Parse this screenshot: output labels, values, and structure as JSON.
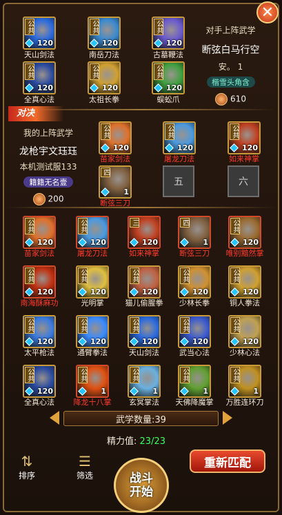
{
  "opponent": {
    "header": "对手上阵武学",
    "name": "断弦白马行空",
    "server": "安。  1",
    "guild": "楷雪头角含",
    "power": "610",
    "skills": [
      {
        "name": "天山剑法",
        "level": "120",
        "tag": "公共",
        "color": "#2a6adf"
      },
      {
        "name": "南岳刀法",
        "level": "120",
        "tag": "公共",
        "color": "#3a8ad0"
      },
      {
        "name": "古墓鞭法",
        "level": "120",
        "tag": "公共",
        "color": "#6a5acf"
      },
      {
        "name": "全真心法",
        "level": "120",
        "tag": "公共",
        "color": "#2a4aa0"
      },
      {
        "name": "太祖长拳",
        "level": "120",
        "tag": "公共",
        "color": "#d0a030"
      },
      {
        "name": "蜈蚣爪",
        "level": "120",
        "tag": "公共",
        "color": "#40a040"
      }
    ]
  },
  "me": {
    "header": "我的上阵武学",
    "name": "龙枪宇文珏珏",
    "server": "本机测试服133",
    "guild": "籍籍无名壹",
    "power": "200",
    "equipped": [
      {
        "name": "苗家剑法",
        "level": "120",
        "tag": "公共",
        "color": "#e0702a"
      },
      {
        "name": "屠龙刀法",
        "level": "120",
        "tag": "公共",
        "color": "#4a9adf"
      },
      {
        "name": "如来神掌",
        "level": "120",
        "tag": "公共",
        "color": "#c04020"
      },
      {
        "name": "断弦三刀",
        "level": "1",
        "tag": "四",
        "color": "#806040"
      }
    ],
    "locked_slots": [
      "五",
      "六"
    ]
  },
  "library": [
    {
      "name": "苗家剑法",
      "level": "120",
      "tag": "公共",
      "color": "#e0702a",
      "red": true
    },
    {
      "name": "屠龙刀法",
      "level": "120",
      "tag": "公共",
      "color": "#4a9adf",
      "red": true
    },
    {
      "name": "如来神掌",
      "level": "120",
      "tag": "三",
      "color": "#c04020",
      "red": true
    },
    {
      "name": "断弦三刀",
      "level": "1",
      "tag": "四",
      "color": "#806040",
      "red": true
    },
    {
      "name": "唯别黯然掌",
      "level": "120",
      "tag": "公共",
      "color": "#9a6a30",
      "red": true
    },
    {
      "name": "南海酥麻功",
      "level": "120",
      "tag": "公共",
      "color": "#c03010",
      "red": true
    },
    {
      "name": "光明掌",
      "level": "120",
      "tag": "公共",
      "color": "#e0c040",
      "red": false
    },
    {
      "name": "猫儿偷腥拳",
      "level": "120",
      "tag": "公共",
      "color": "#c06040",
      "red": false
    },
    {
      "name": "少林长拳",
      "level": "120",
      "tag": "公共",
      "color": "#d09030",
      "red": false
    },
    {
      "name": "铜人拳法",
      "level": "120",
      "tag": "公共",
      "color": "#d0a030",
      "red": false
    },
    {
      "name": "太平枪法",
      "level": "120",
      "tag": "公共",
      "color": "#3a7adf",
      "red": false
    },
    {
      "name": "通臂拳法",
      "level": "120",
      "tag": "公共",
      "color": "#3a8aff",
      "red": false
    },
    {
      "name": "天山剑法",
      "level": "120",
      "tag": "公共",
      "color": "#2a6adf",
      "red": false
    },
    {
      "name": "武当心法",
      "level": "120",
      "tag": "公共",
      "color": "#3a5acf",
      "red": false
    },
    {
      "name": "少林心法",
      "level": "120",
      "tag": "公共",
      "color": "#c0a050",
      "red": false
    },
    {
      "name": "全真心法",
      "level": "120",
      "tag": "公共",
      "color": "#2a4aa0",
      "red": false
    },
    {
      "name": "降龙十八掌",
      "level": "1",
      "tag": "公共",
      "color": "#e05010",
      "red": true
    },
    {
      "name": "玄冥掌法",
      "level": "1",
      "tag": "公共",
      "color": "#6ab0df",
      "red": false
    },
    {
      "name": "天佛降魔掌",
      "level": "1",
      "tag": "公共",
      "color": "#60a030",
      "red": false
    },
    {
      "name": "万胜连环刀",
      "level": "1",
      "tag": "公共",
      "color": "#c09020",
      "red": false
    }
  ],
  "footer": {
    "count_label": "武学数量:39",
    "energy_label": "精力值:",
    "energy_value": "23/23",
    "sort_label": "排序",
    "filter_label": "筛选",
    "start_label_1": "战斗",
    "start_label_2": "开始",
    "rematch_label": "重新匹配",
    "vs_label": "对决"
  }
}
